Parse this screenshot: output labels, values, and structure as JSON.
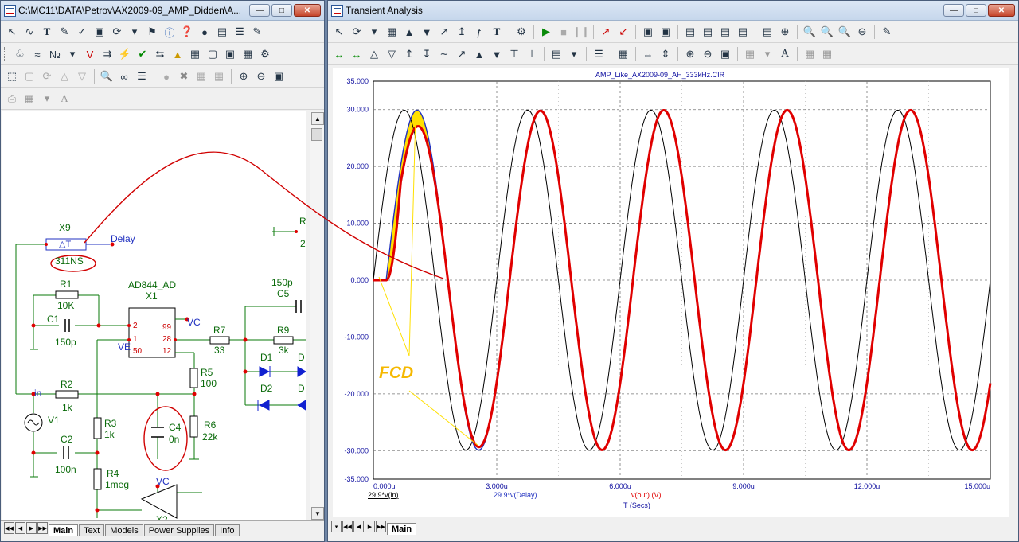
{
  "left_window": {
    "title": "C:\\MC11\\DATA\\Petrov\\AX2009-09_AMP_Didden\\A...",
    "tabs": [
      "Main",
      "Text",
      "Models",
      "Power Supplies",
      "Info"
    ],
    "active_tab": "Main"
  },
  "schematic": {
    "x9_label": "X9",
    "x9_value": "311NS",
    "x9_symbol": "△T",
    "delay_label": "Delay",
    "r1": "R1",
    "r1_val": "10K",
    "c1": "C1",
    "c1_val": "150p",
    "ad844": "AD844_AD",
    "x1": "X1",
    "pin2": "2",
    "pin1": "1",
    "pin50": "50",
    "pin99": "99",
    "pin28": "28",
    "pin12": "12",
    "vc1": "VC",
    "ve": "VE",
    "r7": "R7",
    "r7_val": "33",
    "r9": "R9",
    "r9_val": "3k",
    "c5_val": "150p",
    "c5": "C5",
    "r5": "R5",
    "r5_val": "100",
    "r6": "R6",
    "r6_val": "22k",
    "c4": "C4",
    "c4_val": "0n",
    "in_label": "in",
    "r2": "R2",
    "r2_val": "1k",
    "v1": "V1",
    "r3": "R3",
    "r3_val": "1k",
    "c2": "C2",
    "c2_val": "100n",
    "r4": "R4",
    "r4_val": "1meg",
    "vc2": "VC",
    "d1": "D1",
    "d2": "D2",
    "d_right1": "D",
    "d_right2": "D",
    "r_partial": "R",
    "r_partial_val": "2",
    "x_partial": "X2"
  },
  "right_window": {
    "title": "Transient Analysis",
    "tabs": [
      "Main"
    ],
    "active_tab": "Main"
  },
  "plot_header": "AMP_Like_AX2009-09_AH_333kHz.CIR",
  "annotation": {
    "text": "FCD",
    "color": "#f5b800"
  },
  "legend": {
    "trace1": "29.9*v(in)",
    "trace2": "29.9*v(Delay)",
    "trace3": "v(out) (V)",
    "xlabel": "T (Secs)"
  },
  "colors": {
    "in": "#000000",
    "delay": "#2030c0",
    "out": "#e00000",
    "fill": "#ffe000",
    "axis_text": "#1010a0"
  },
  "chart_data": {
    "type": "line",
    "x_unit": "us",
    "xlim": [
      0,
      15
    ],
    "ylim": [
      -35,
      35
    ],
    "x_ticks": [
      "0.000u",
      "3.000u",
      "6.000u",
      "9.000u",
      "12.000u",
      "15.000u"
    ],
    "y_ticks": [
      "35.000",
      "30.000",
      "20.000",
      "10.000",
      "0.000",
      "-10.000",
      "-20.000",
      "-30.000",
      "-35.000"
    ],
    "y_tick_values": [
      35,
      30,
      20,
      10,
      0,
      -10,
      -20,
      -30,
      -35
    ],
    "x_tick_values": [
      0,
      3,
      6,
      9,
      12,
      15
    ],
    "grid": true,
    "series": [
      {
        "name": "29.9*v(in)",
        "amplitude": 29.9,
        "period_us": 3.0,
        "delay_us": 0
      },
      {
        "name": "29.9*v(Delay)",
        "amplitude": 29.9,
        "period_us": 3.0,
        "delay_us": 0.311
      },
      {
        "name": "v(out) (V)",
        "amplitude": 29.9,
        "period_us": 3.0,
        "delay_us": 0.311
      }
    ]
  }
}
